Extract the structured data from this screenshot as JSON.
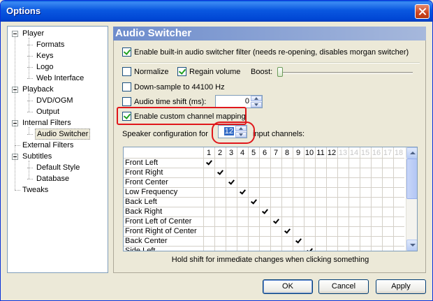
{
  "window": {
    "title": "Options"
  },
  "tree": {
    "items": [
      {
        "label": "Player",
        "level": 0
      },
      {
        "label": "Formats",
        "level": 1
      },
      {
        "label": "Keys",
        "level": 1
      },
      {
        "label": "Logo",
        "level": 1
      },
      {
        "label": "Web Interface",
        "level": 1
      },
      {
        "label": "Playback",
        "level": 0
      },
      {
        "label": "DVD/OGM",
        "level": 1
      },
      {
        "label": "Output",
        "level": 1
      },
      {
        "label": "Internal Filters",
        "level": 0
      },
      {
        "label": "Audio Switcher",
        "level": 1,
        "selected": true
      },
      {
        "label": "External Filters",
        "level": 0
      },
      {
        "label": "Subtitles",
        "level": 0
      },
      {
        "label": "Default Style",
        "level": 1
      },
      {
        "label": "Database",
        "level": 1
      },
      {
        "label": "Tweaks",
        "level": 0
      }
    ]
  },
  "panel": {
    "title": "Audio Switcher",
    "enable_switcher": {
      "label": "Enable built-in audio switcher filter (needs re-opening, disables morgan switcher)",
      "checked": true
    },
    "normalize": {
      "label": "Normalize",
      "checked": false
    },
    "regain_volume": {
      "label": "Regain volume",
      "checked": true
    },
    "boost": {
      "label": "Boost:",
      "value": 0
    },
    "downsample": {
      "label": "Down-sample to 44100 Hz",
      "checked": false
    },
    "time_shift": {
      "label": "Audio time shift (ms):",
      "checked": false,
      "value": "0"
    },
    "custom_mapping": {
      "label": "Enable custom channel mapping",
      "checked": true
    },
    "speaker_config": {
      "prefix": "Speaker configuration for",
      "value": "12",
      "suffix": "input channels:"
    },
    "matrix": {
      "columns": [
        "1",
        "2",
        "3",
        "4",
        "5",
        "6",
        "7",
        "8",
        "9",
        "10",
        "11",
        "12",
        "13",
        "14",
        "15",
        "16",
        "17",
        "18"
      ],
      "active_columns": 12,
      "rows": [
        "Front Left",
        "Front Right",
        "Front Center",
        "Low Frequency",
        "Back Left",
        "Back Right",
        "Front Left of Center",
        "Front Right of Center",
        "Back Center",
        "Side Left"
      ],
      "checks": [
        [
          0,
          0
        ],
        [
          1,
          1
        ],
        [
          2,
          2
        ],
        [
          3,
          3
        ],
        [
          4,
          4
        ],
        [
          5,
          5
        ],
        [
          6,
          6
        ],
        [
          7,
          7
        ],
        [
          8,
          8
        ],
        [
          9,
          9
        ]
      ]
    },
    "hint": "Hold shift for immediate changes when clicking something"
  },
  "buttons": {
    "ok": "OK",
    "cancel": "Cancel",
    "apply": "Apply"
  },
  "colors": {
    "title_bar": "#0a58e0",
    "accent_red": "#e0171b",
    "panel_header": "#6d8ccc"
  }
}
